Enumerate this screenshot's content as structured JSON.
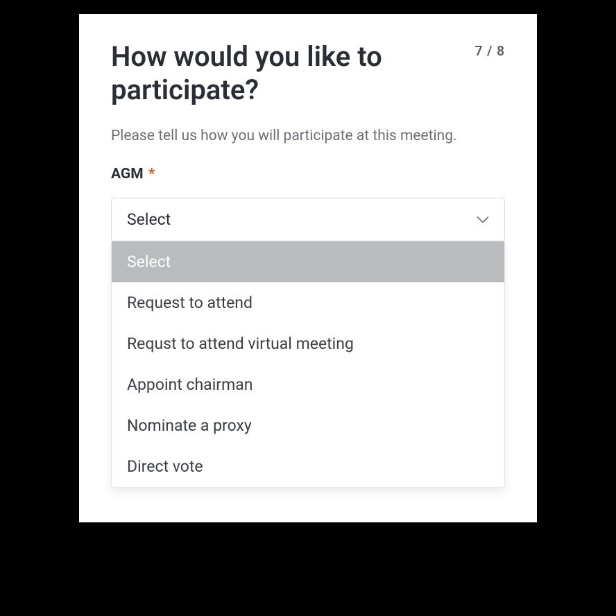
{
  "step": {
    "current": 7,
    "total": 8,
    "display": "7 / 8"
  },
  "title": "How would you like to participate?",
  "subtitle": "Please tell us how you will participate at this meeting.",
  "field": {
    "label": "AGM",
    "required_mark": "*",
    "selected_value": "Select",
    "options": [
      "Select",
      "Request to attend",
      "Requst to attend virtual meeting",
      "Appoint chairman",
      "Nominate a proxy",
      "Direct vote"
    ]
  }
}
